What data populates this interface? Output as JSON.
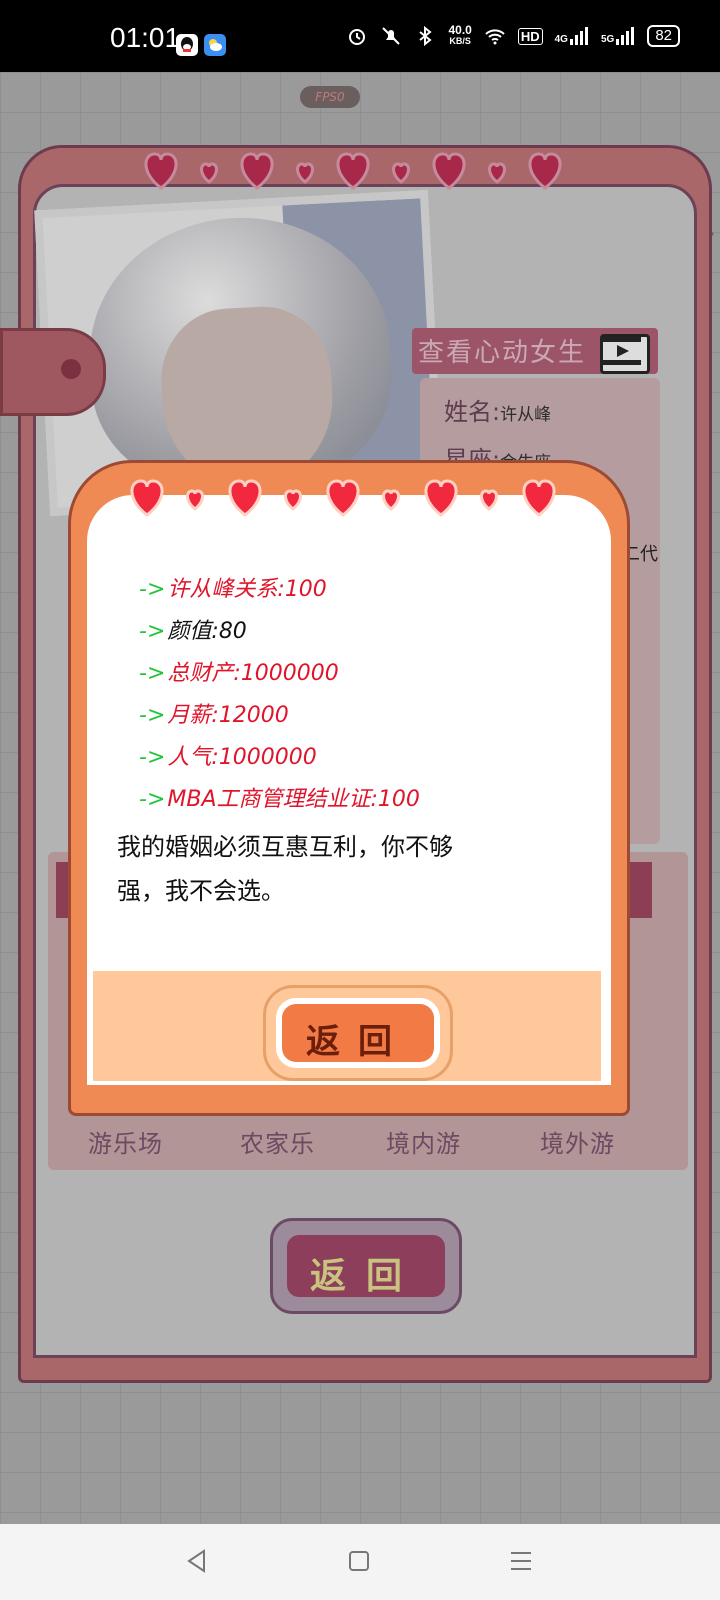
{
  "status_bar": {
    "time": "01:01",
    "net_speed_value": "40.0",
    "net_speed_unit": "KB/S",
    "hd_label": "HD",
    "sig1": "4G",
    "sig2": "5G",
    "battery": "82"
  },
  "game": {
    "fps_label": "FPS0",
    "view_heart_girl": "查看心动女生",
    "profile": {
      "name_label": "姓名:",
      "name_value": "许从峰",
      "sign_label": "星座:",
      "sign_value": "金牛座",
      "partial_value": "二代"
    },
    "categories": [
      "游乐场",
      "农家乐",
      "境内游",
      "境外游"
    ],
    "bg_return_label": "返回"
  },
  "dialog": {
    "stats": [
      {
        "label": "许从峰关系",
        "value": "100",
        "color": "red"
      },
      {
        "label": "颜值",
        "value": "80",
        "color": "black"
      },
      {
        "label": "总财产",
        "value": "1000000",
        "color": "red"
      },
      {
        "label": "月薪",
        "value": "12000",
        "color": "red"
      },
      {
        "label": "人气",
        "value": "1000000",
        "color": "red"
      },
      {
        "label": "MBA工商管理结业证",
        "value": "100",
        "color": "red"
      }
    ],
    "arrow": "->",
    "quote_line1": "我的婚姻必须互惠互利，你不够",
    "quote_line2": "强，我不会选。",
    "return_label": "返回"
  }
}
